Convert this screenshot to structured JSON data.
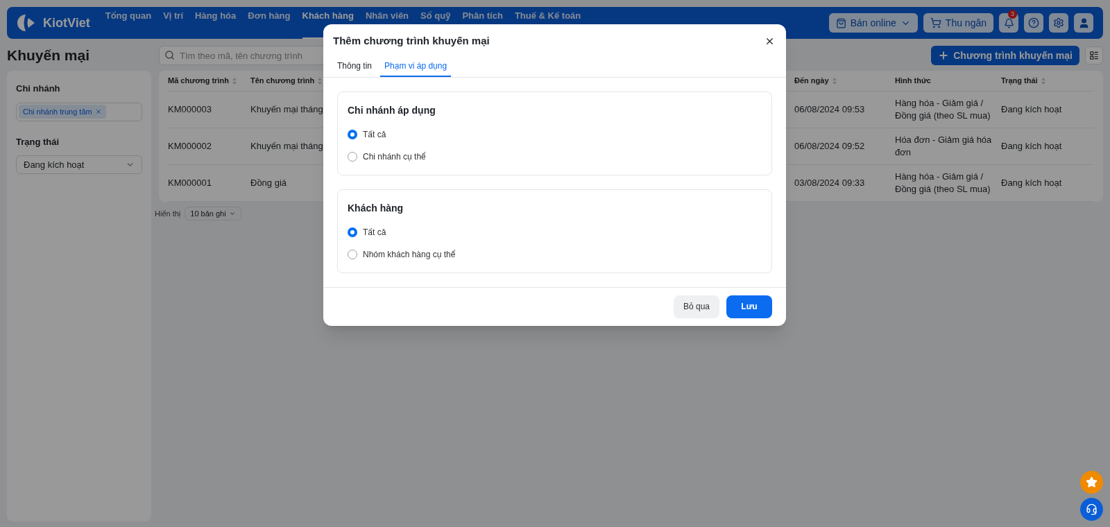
{
  "nav": {
    "logo": "KiotViet",
    "items": [
      {
        "label": "Tổng quan",
        "selected": false
      },
      {
        "label": "Vị trí",
        "selected": false
      },
      {
        "label": "Hàng hóa",
        "selected": false
      },
      {
        "label": "Đơn hàng",
        "selected": false
      },
      {
        "label": "Khách hàng",
        "selected": true
      },
      {
        "label": "Nhân viên",
        "selected": false
      },
      {
        "label": "Sổ quỹ",
        "selected": false
      },
      {
        "label": "Phân tích",
        "selected": false
      },
      {
        "label": "Thuế & Kế toán",
        "selected": false
      }
    ],
    "online_button": "Bán online",
    "cashier_button": "Thu ngân",
    "notification_count": "3"
  },
  "page": {
    "title": "Khuyến mại",
    "search": {
      "placeholder": "Tìm theo mã, tên chương trình"
    },
    "add_button": "Chương trình khuyến mại"
  },
  "filters": [
    {
      "kind": "tags",
      "label": "Chi nhánh",
      "tags": [
        "Chi nhánh trung tâm"
      ]
    },
    {
      "kind": "select",
      "label": "Trạng thái",
      "value": "Đang kích hoạt"
    }
  ],
  "table": {
    "columns": [
      {
        "label": "Mã chương trình",
        "sortable": true
      },
      {
        "label": "Tên chương trình",
        "sortable": true
      },
      {
        "label": "Đến ngày",
        "sortable": true
      },
      {
        "label": "Hình thức",
        "sortable": false
      },
      {
        "label": "Trạng thái",
        "sortable": true
      }
    ],
    "rows": [
      {
        "cells": [
          "KM000003",
          "Khuyến mại tháng",
          "06/08/2024 09:53",
          "Hàng hóa - Giảm giá / Đồng giá (theo SL mua)",
          "Đang kích hoạt"
        ]
      },
      {
        "cells": [
          "KM000002",
          "Khuyến mại tháng",
          "06/08/2024 09:52",
          "Hóa đơn - Giảm giá hóa đơn",
          "Đang kích hoạt"
        ]
      },
      {
        "cells": [
          "KM000001",
          "Đồng giá",
          "03/08/2024 09:33",
          "Hàng hóa - Giảm giá / Đồng giá (theo SL mua)",
          "Đang kích hoạt"
        ]
      }
    ],
    "footer": {
      "label": "Hiển thị",
      "page_size": "10 bản ghi"
    }
  },
  "dialog": {
    "title": "Thêm chương trình khuyến mại",
    "tabs": [
      {
        "label": "Thông tin",
        "selected": false
      },
      {
        "label": "Phạm vi áp dụng",
        "selected": true
      }
    ],
    "sections": [
      {
        "title": "Chi nhánh áp dụng",
        "options": [
          {
            "label": "Tất cả",
            "selected": true
          },
          {
            "label": "Chi nhánh cụ thể",
            "selected": false
          }
        ]
      },
      {
        "title": "Khách hàng",
        "options": [
          {
            "label": "Tất cả",
            "selected": true
          },
          {
            "label": "Nhóm khách hàng cụ thể",
            "selected": false
          }
        ]
      }
    ],
    "buttons": [
      {
        "label": "Bỏ qua",
        "kind": "secondary"
      },
      {
        "label": "Lưu",
        "kind": "primary"
      }
    ]
  }
}
